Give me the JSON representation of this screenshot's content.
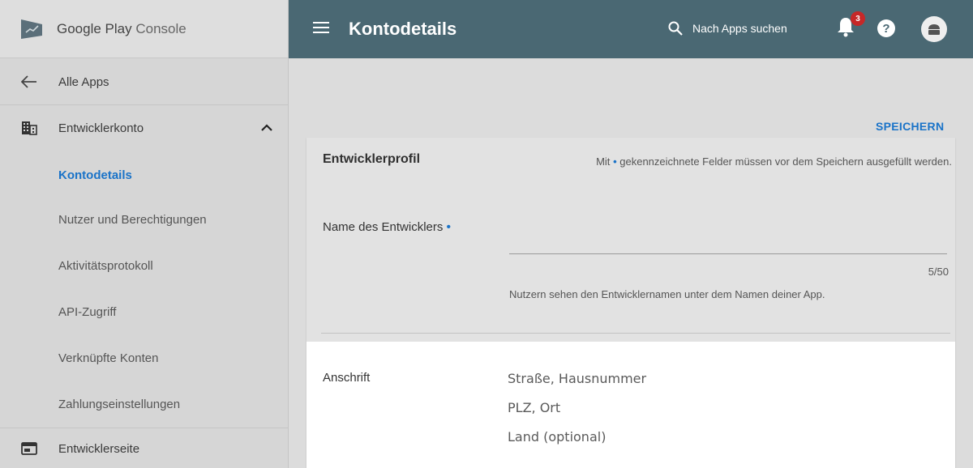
{
  "brand": {
    "name_bold": "Google Play",
    "name_light": "Console"
  },
  "topbar": {
    "title": "Kontodetails",
    "search_placeholder": "Nach Apps suchen",
    "notification_count": "3",
    "help_symbol": "?"
  },
  "sidebar": {
    "back_label": "Alle Apps",
    "section_label": "Entwicklerkonto",
    "items": [
      {
        "label": "Kontodetails",
        "active": true
      },
      {
        "label": "Nutzer und Berechtigungen",
        "active": false
      },
      {
        "label": "Aktivitätsprotokoll",
        "active": false
      },
      {
        "label": "API-Zugriff",
        "active": false
      },
      {
        "label": "Verknüpfte Konten",
        "active": false
      },
      {
        "label": "Zahlungseinstellungen",
        "active": false
      }
    ],
    "developer_page_label": "Entwicklerseite"
  },
  "main": {
    "save_label": "SPEICHERN",
    "card_title": "Entwicklerprofil",
    "req_note_prefix": "Mit",
    "req_note_suffix": "gekennzeichnete Felder müssen vor dem Speichern ausgefüllt werden.",
    "developer_name_label": "Name des Entwicklers",
    "developer_name_value": "",
    "counter": "5/50",
    "helper_text": "Nutzern sehen den Entwicklernamen unter dem Namen deiner App.",
    "address_label": "Anschrift",
    "address_lines": [
      "Straße, Hausnummer",
      "PLZ, Ort",
      "Land (optional)"
    ]
  },
  "colors": {
    "topbar": "#4a6873",
    "accent": "#1a73c8",
    "badge": "#c62828"
  }
}
